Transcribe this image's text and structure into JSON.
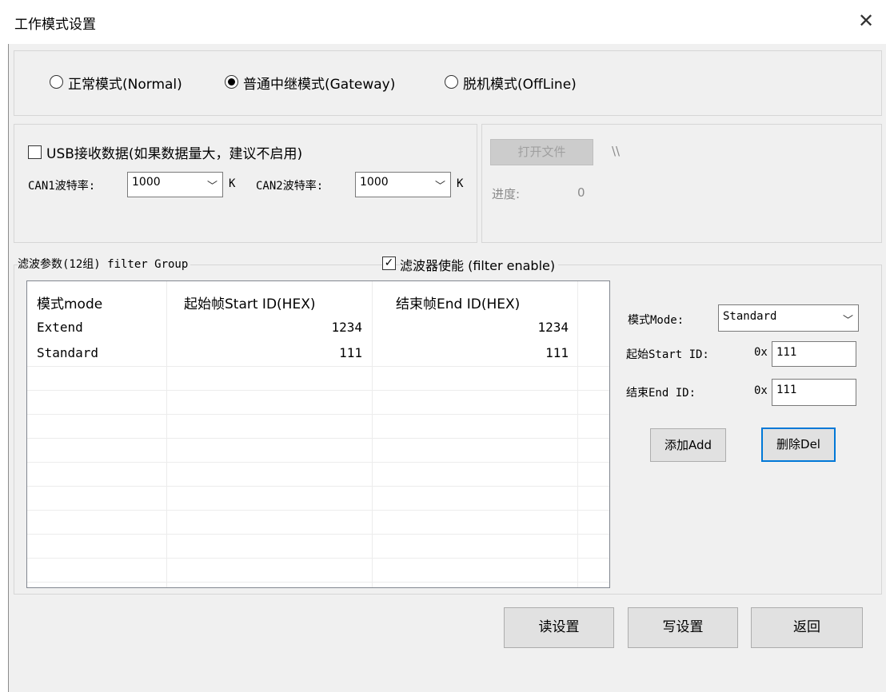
{
  "window": {
    "title": "工作模式设置"
  },
  "mode": {
    "options": [
      {
        "label": "正常模式(Normal)",
        "selected": false
      },
      {
        "label": "普通中继模式(Gateway)",
        "selected": true
      },
      {
        "label": "脱机模式(OffLine)",
        "selected": false
      }
    ]
  },
  "usb": {
    "checkbox_label": "USB接收数据(如果数据量大，建议不启用)",
    "checked": false,
    "can1_label": "CAN1波特率:",
    "can1_value": "1000",
    "can2_label": "CAN2波特率:",
    "can2_value": "1000",
    "unit": "K"
  },
  "offline": {
    "open_file_label": "打开文件",
    "path": "\\\\",
    "progress_label": "进度:",
    "progress_value": "0"
  },
  "filter": {
    "group_label": "滤波参数(12组) filter Group",
    "enable_label": "滤波器使能 (filter enable)",
    "enabled": true,
    "columns": [
      "模式mode",
      "起始帧Start ID(HEX)",
      "结束帧End ID(HEX)"
    ],
    "rows": [
      [
        "Extend",
        "1234",
        "1234"
      ],
      [
        "Standard",
        "111",
        "111"
      ]
    ],
    "mode_label": "模式Mode:",
    "mode_value": "Standard",
    "start_label": "起始Start ID:",
    "start_prefix": "0x",
    "start_value": "111",
    "end_label": "结束End ID:",
    "end_prefix": "0x",
    "end_value": "111",
    "add_label": "添加Add",
    "del_label": "删除Del"
  },
  "footer": {
    "read_label": "读设置",
    "write_label": "写设置",
    "back_label": "返回"
  },
  "icons": {
    "close": "close-icon",
    "chevron": "chevron-down-icon",
    "check": "checkmark-icon"
  }
}
